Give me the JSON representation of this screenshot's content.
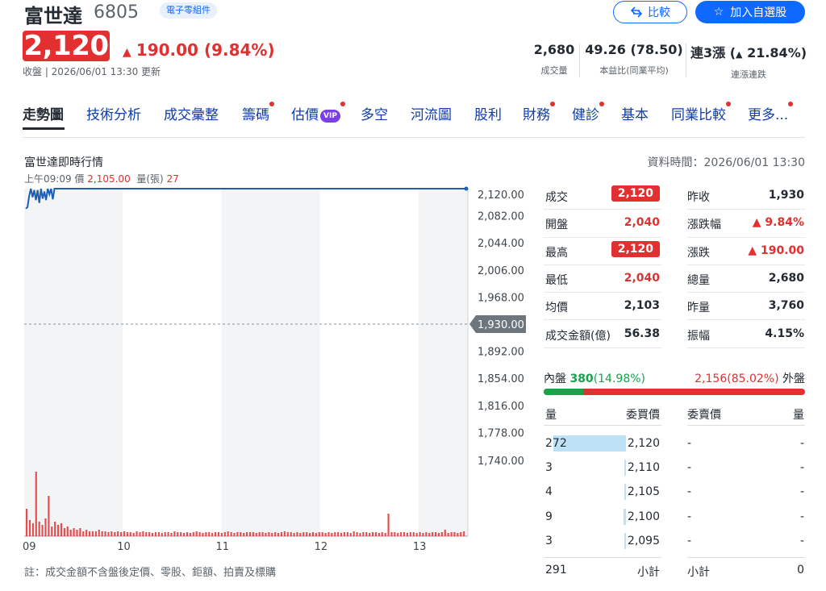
{
  "header": {
    "name": "富世達",
    "code": "6805",
    "industry": "電子零組件",
    "compare_label": "比較",
    "watchlist_label": "加入自選股",
    "price": "2,120",
    "change": "190.00",
    "change_pct": "(9.84%)",
    "close_status": "收盤 | 2026/06/01 13:30 更新",
    "stats": [
      {
        "value": "2,680",
        "label": "成交量"
      },
      {
        "value": "49.26 (78.50)",
        "label": "本益比(同業平均)"
      },
      {
        "value_prefix": "連3漲",
        "value": "21.84%",
        "label": "連漲連跌"
      }
    ]
  },
  "tabs": [
    {
      "label": "走勢圖",
      "active": true,
      "dot": false
    },
    {
      "label": "技術分析",
      "dot": false
    },
    {
      "label": "成交彙整",
      "dot": false
    },
    {
      "label": "籌碼",
      "dot": true
    },
    {
      "label": "估價",
      "vip": "VIP",
      "dot": true
    },
    {
      "label": "多空",
      "dot": false
    },
    {
      "label": "河流圖",
      "dot": false
    },
    {
      "label": "股利",
      "dot": false
    },
    {
      "label": "財務",
      "dot": true
    },
    {
      "label": "健診",
      "dot": true
    },
    {
      "label": "基本",
      "dot": false
    },
    {
      "label": "同業比較",
      "dot": true
    },
    {
      "label": "更多...",
      "dot": true
    }
  ],
  "chart_section": {
    "title": "富世達即時行情",
    "data_time": "資料時間：2026/06/01 13:30",
    "hover_time": "上午09:09",
    "hover_price_label": "價",
    "hover_price": "2,105.00",
    "hover_vol_label": "量(張)",
    "hover_vol": "27",
    "note": "註：成交金額不含盤後定價、零股、鉅額、拍賣及標購"
  },
  "chart_data": {
    "type": "line",
    "y_ticks": [
      "2,120.00",
      "2,082.00",
      "2,044.00",
      "2,006.00",
      "1,968.00",
      "1,930.00",
      "1,892.00",
      "1,854.00",
      "1,816.00",
      "1,778.00",
      "1,740.00"
    ],
    "x_ticks": [
      "09",
      "10",
      "11",
      "12",
      "13"
    ],
    "ylim": [
      1740,
      2120
    ],
    "reference_price": 1930,
    "reference_label": "1,930.00",
    "price_series": [
      2092,
      2094,
      2110,
      2120,
      2108,
      2118,
      2104,
      2118,
      2100,
      2120,
      2106,
      2116,
      2104,
      2120,
      2112,
      2120,
      2105,
      2120,
      2120,
      2120,
      2120,
      2120,
      2120
    ],
    "volume_bars": [
      34,
      20,
      16,
      80,
      18,
      14,
      22,
      50,
      12,
      18,
      14,
      16,
      10,
      12,
      8,
      10,
      8,
      10,
      6,
      8,
      6,
      6,
      6,
      8,
      6,
      6,
      5,
      6,
      5,
      6,
      5,
      6,
      5,
      5,
      4,
      6,
      5,
      6,
      5,
      5,
      4,
      5,
      5,
      4,
      5,
      5,
      4,
      6,
      5,
      5,
      4,
      5,
      4,
      5,
      6,
      5,
      4,
      5,
      5,
      4,
      5,
      5,
      4,
      5,
      6,
      5,
      4,
      5,
      5,
      4,
      5,
      5,
      5,
      4,
      5,
      5,
      4,
      5,
      4,
      5,
      4,
      5,
      6,
      5,
      5,
      4,
      5,
      4,
      5,
      5,
      4,
      5,
      4,
      5,
      5,
      4,
      5,
      4,
      5,
      5,
      4,
      5,
      5,
      4,
      6,
      5,
      4,
      5,
      5,
      4,
      5,
      5,
      4,
      5,
      4,
      28,
      5,
      5,
      4,
      5,
      5,
      4,
      5,
      5,
      4,
      5,
      4,
      5,
      4,
      5,
      5,
      4,
      5,
      8,
      4,
      5,
      5,
      4,
      5,
      6
    ],
    "grid": true
  },
  "quote": {
    "left": [
      {
        "label": "成交",
        "value": "2,120",
        "pill": true
      },
      {
        "label": "開盤",
        "value": "2,040"
      },
      {
        "label": "最高",
        "value": "2,120",
        "pill": true
      },
      {
        "label": "最低",
        "value": "2,040"
      },
      {
        "label": "均價",
        "value": "2,103"
      },
      {
        "label": "成交金額(億)",
        "value": "56.38"
      }
    ],
    "right": [
      {
        "label": "昨收",
        "value": "1,930"
      },
      {
        "label": "漲跌幅",
        "value": "9.84%",
        "up": true
      },
      {
        "label": "漲跌",
        "value": "190.00",
        "up": true
      },
      {
        "label": "總量",
        "value": "2,680"
      },
      {
        "label": "昨量",
        "value": "3,760"
      },
      {
        "label": "振幅",
        "value": "4.15%"
      }
    ]
  },
  "inner_outer": {
    "inner_label": "內盤",
    "inner_value": "380",
    "inner_pct": "(14.98%)",
    "inner_fraction": 0.1498,
    "outer_value": "2,156",
    "outer_pct": "(85.02%)",
    "outer_label": "外盤"
  },
  "orderbook": {
    "headers": [
      "量",
      "委買價",
      "委賣價",
      "量"
    ],
    "rows": [
      {
        "bid_vol": "272",
        "bid": "2,120",
        "ask": "-",
        "ask_vol": "-",
        "bar": 0.9
      },
      {
        "bid_vol": "3",
        "bid": "2,110",
        "ask": "-",
        "ask_vol": "-",
        "bar": 0.01
      },
      {
        "bid_vol": "4",
        "bid": "2,105",
        "ask": "-",
        "ask_vol": "-",
        "bar": 0.015
      },
      {
        "bid_vol": "9",
        "bid": "2,100",
        "ask": "-",
        "ask_vol": "-",
        "bar": 0.03
      },
      {
        "bid_vol": "3",
        "bid": "2,095",
        "ask": "-",
        "ask_vol": "-",
        "bar": 0.01
      }
    ],
    "footer": {
      "bid_total": "291",
      "bid_label": "小計",
      "ask_label": "小計",
      "ask_total": "0"
    }
  },
  "colors": {
    "up": "#e22f2f",
    "down": "#16a34a",
    "accent": "#0f69ff",
    "line": "#1b5fb8"
  }
}
